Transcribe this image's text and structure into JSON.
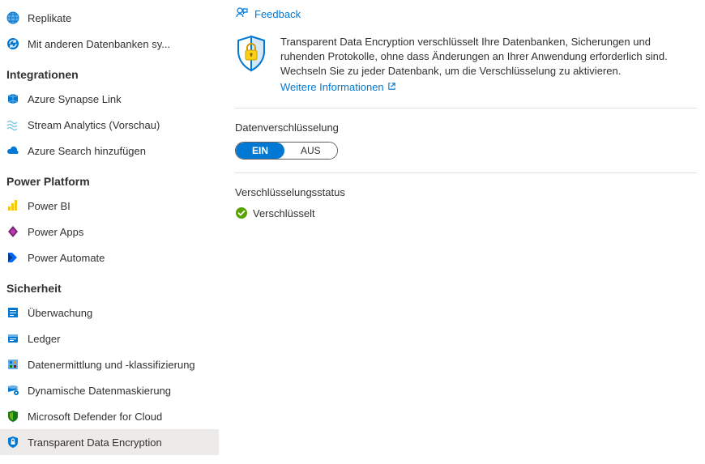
{
  "feedback": {
    "label": "Feedback"
  },
  "info": {
    "text": "Transparent Data Encryption verschlüsselt Ihre Datenbanken, Sicherungen und ruhenden Protokolle, ohne dass Änderungen an Ihrer Anwendung erforderlich sind. Wechseln Sie zu jeder Datenbank, um die Verschlüsselung zu aktivieren.",
    "more": "Weitere Informationen"
  },
  "toggle": {
    "label": "Datenverschlüsselung",
    "on": "EIN",
    "off": "AUS",
    "value": "EIN"
  },
  "status": {
    "label": "Verschlüsselungsstatus",
    "value": "Verschlüsselt",
    "state": "ok"
  },
  "sidebar": {
    "items": [
      {
        "label": "Replikate"
      },
      {
        "label": "Mit anderen Datenbanken sy..."
      }
    ],
    "integrationen": {
      "header": "Integrationen",
      "items": [
        {
          "label": "Azure Synapse Link"
        },
        {
          "label": "Stream Analytics (Vorschau)"
        },
        {
          "label": "Azure Search hinzufügen"
        }
      ]
    },
    "power_platform": {
      "header": "Power Platform",
      "items": [
        {
          "label": "Power BI"
        },
        {
          "label": "Power Apps"
        },
        {
          "label": "Power Automate"
        }
      ]
    },
    "sicherheit": {
      "header": "Sicherheit",
      "items": [
        {
          "label": "Überwachung"
        },
        {
          "label": "Ledger"
        },
        {
          "label": "Datenermittlung und -klassifizierung"
        },
        {
          "label": "Dynamische Datenmaskierung"
        },
        {
          "label": "Microsoft Defender for Cloud"
        },
        {
          "label": "Transparent Data Encryption",
          "selected": true
        }
      ]
    }
  }
}
